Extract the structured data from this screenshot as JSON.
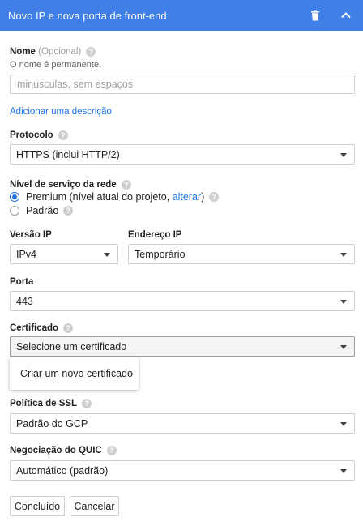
{
  "header": {
    "title": "Novo IP e nova porta de front-end"
  },
  "name": {
    "label": "Nome",
    "optional": "(Opcional)",
    "hint": "O nome é permanente.",
    "placeholder": "minúsculas, sem espaços"
  },
  "add_description": "Adicionar uma descrição",
  "protocol": {
    "label": "Protocolo",
    "value": "HTTPS (inclui HTTP/2)"
  },
  "network_tier": {
    "label": "Nível de serviço da rede",
    "premium_label": "Premium (nível atual do projeto, ",
    "premium_link": "alterar",
    "premium_suffix": ")",
    "standard_label": "Padrão",
    "selected": "Premium"
  },
  "ip_version": {
    "label": "Versão IP",
    "value": "IPv4"
  },
  "ip_address": {
    "label": "Endereço IP",
    "value": "Temporário"
  },
  "port": {
    "label": "Porta",
    "value": "443"
  },
  "certificate": {
    "label": "Certificado",
    "value": "Selecione um certificado",
    "menu_item": "Criar um novo certificado"
  },
  "ssl_policy": {
    "label": "Política de SSL",
    "value": "Padrão do GCP"
  },
  "quic": {
    "label": "Negociação do QUIC",
    "value": "Automático (padrão)"
  },
  "buttons": {
    "done": "Concluído",
    "cancel": "Cancelar"
  },
  "icons": {
    "help": "?",
    "delete": "trash-icon",
    "collapse": "chevron-up-icon"
  },
  "colors": {
    "header": "#3f7fe6",
    "accent": "#1a73e8"
  }
}
